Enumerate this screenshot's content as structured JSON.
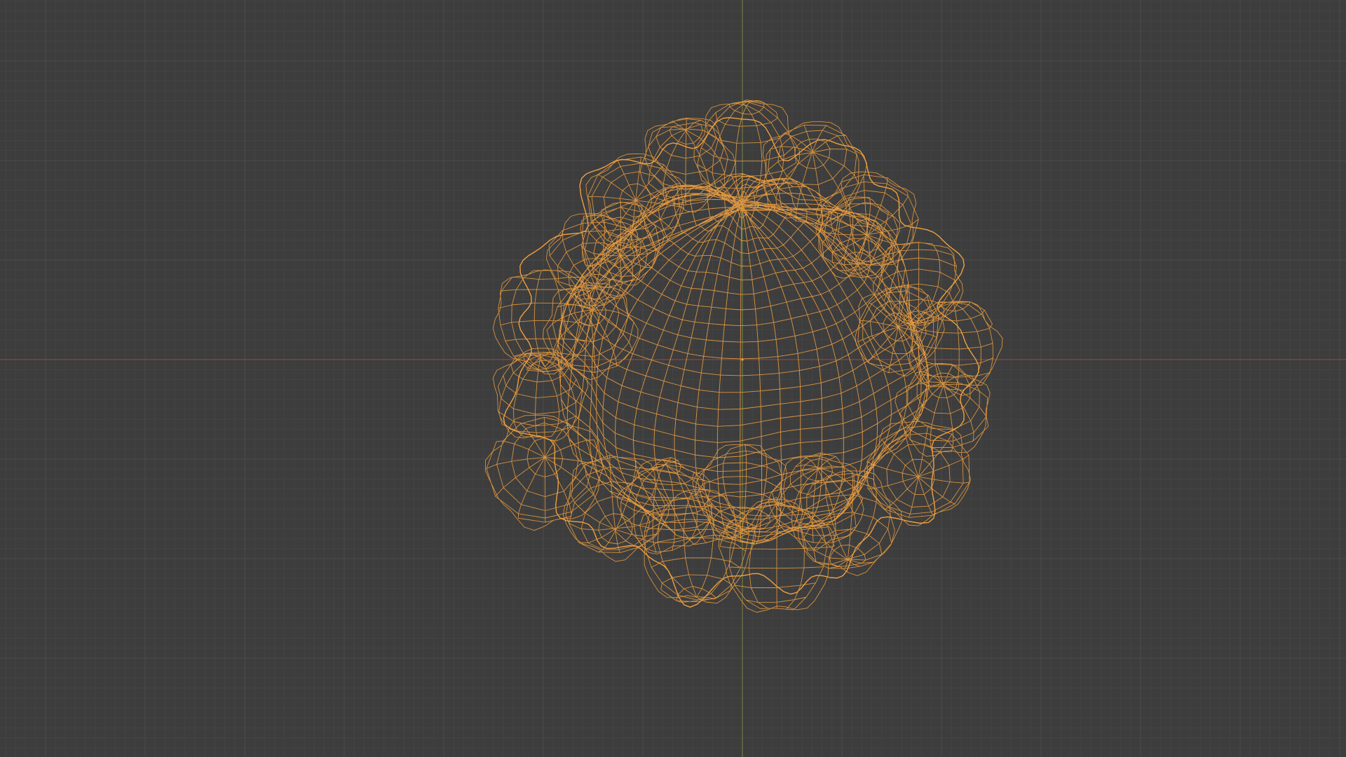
{
  "viewport": {
    "background_color": "#3d3d3d",
    "grid_minor_color": "#444444",
    "grid_major_color": "#4b4b4b",
    "x_axis_color": "#8a4a42",
    "y_axis_color": "#6d7a45",
    "object_wire_color": "#f0a040",
    "object_outline_color": "#f2a33a"
  },
  "object": {
    "display_mode": "wireframe",
    "selected": true,
    "shape": "lumpy-sphere-mesh"
  }
}
